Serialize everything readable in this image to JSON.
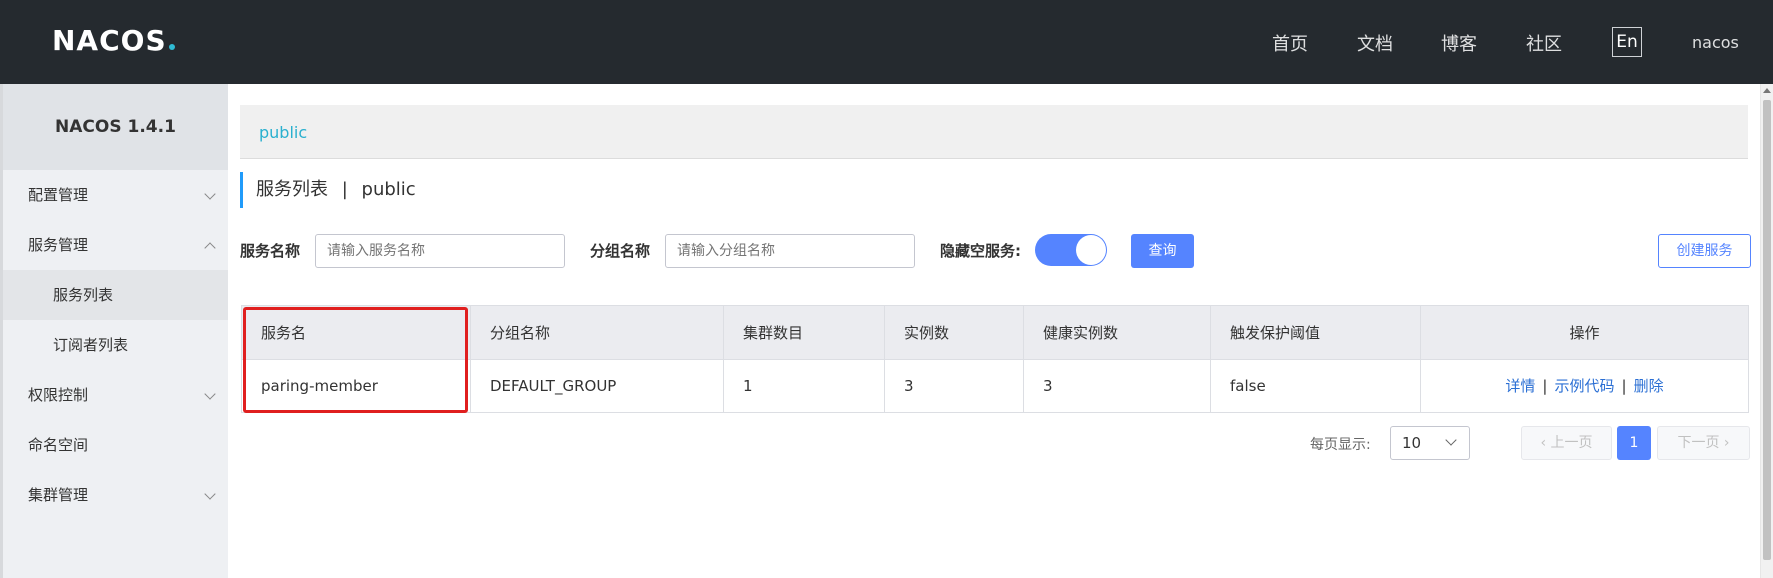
{
  "header": {
    "logo": "NACOS",
    "nav": [
      "首页",
      "文档",
      "博客",
      "社区"
    ],
    "lang": "En",
    "user": "nacos"
  },
  "sidebar": {
    "title": "NACOS 1.4.1",
    "items": [
      {
        "label": "配置管理",
        "chevron": "down"
      },
      {
        "label": "服务管理",
        "chevron": "up"
      },
      {
        "label": "服务列表",
        "sub": true,
        "active": true
      },
      {
        "label": "订阅者列表",
        "sub": true
      },
      {
        "label": "权限控制",
        "chevron": "down"
      },
      {
        "label": "命名空间"
      },
      {
        "label": "集群管理",
        "chevron": "down"
      }
    ]
  },
  "breadcrumb": "public",
  "page": {
    "title": "服务列表",
    "separator": "|",
    "namespace": "public"
  },
  "filters": {
    "service_name_label": "服务名称",
    "service_name_placeholder": "请输入服务名称",
    "group_name_label": "分组名称",
    "group_name_placeholder": "请输入分组名称",
    "hide_empty_label": "隐藏空服务:",
    "hide_empty_on": true,
    "query_button": "查询",
    "create_button": "创建服务"
  },
  "table": {
    "headers": [
      "服务名",
      "分组名称",
      "集群数目",
      "实例数",
      "健康实例数",
      "触发保护阈值",
      "操作"
    ],
    "rows": [
      {
        "service": "paring-member",
        "group": "DEFAULT_GROUP",
        "clusters": "1",
        "instances": "3",
        "healthy": "3",
        "protect": "false",
        "ops": [
          "详情",
          "示例代码",
          "删除"
        ]
      }
    ]
  },
  "pagination": {
    "page_size_label": "每页显示:",
    "page_size": "10",
    "prev": "上一页",
    "current": "1",
    "next": "下一页"
  },
  "colors": {
    "header_bg": "#252a2f",
    "accent": "#5584ff",
    "link": "#2b6fd4",
    "breadcrumb": "#2ab0cf",
    "highlight": "#e01f1f"
  }
}
